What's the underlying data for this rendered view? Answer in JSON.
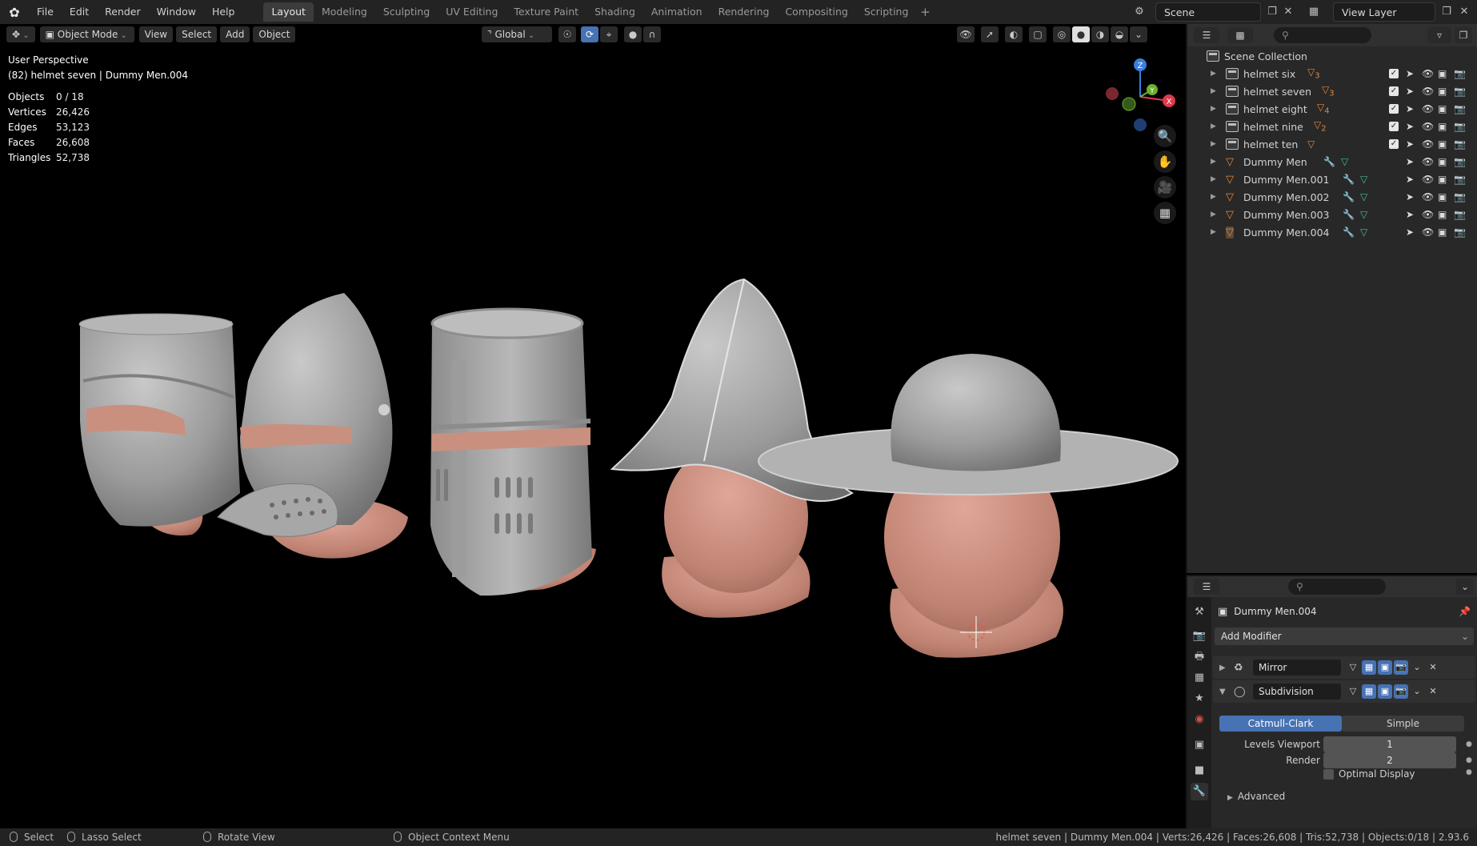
{
  "topbar": {
    "menus": [
      "File",
      "Edit",
      "Render",
      "Window",
      "Help"
    ],
    "workspaces": [
      "Layout",
      "Modeling",
      "Sculpting",
      "UV Editing",
      "Texture Paint",
      "Shading",
      "Animation",
      "Rendering",
      "Compositing",
      "Scripting"
    ],
    "active_workspace": "Layout",
    "scene": "Scene",
    "view_layer": "View Layer"
  },
  "viewport": {
    "mode": "Object Mode",
    "menus": [
      "View",
      "Select",
      "Add",
      "Object"
    ],
    "transform_orientation": "Global",
    "perspective_label": "User Perspective",
    "context_label": "(82) helmet seven | Dummy Men.004",
    "stats": [
      {
        "key": "Objects",
        "value": "0 / 18"
      },
      {
        "key": "Vertices",
        "value": "26,426"
      },
      {
        "key": "Edges",
        "value": "53,123"
      },
      {
        "key": "Faces",
        "value": "26,608"
      },
      {
        "key": "Triangles",
        "value": "52,738"
      }
    ],
    "gizmo_axes": {
      "z": "Z",
      "y": "Y",
      "x": "X"
    },
    "colors": {
      "x_axis": "#e0394d",
      "y_axis": "#6bb02b",
      "z_axis": "#3a7ee0",
      "skin": "#c28575",
      "metal": "#a6a6a6"
    }
  },
  "outliner": {
    "search_placeholder": "",
    "scene_collection": "Scene Collection",
    "items": [
      {
        "label": "helmet six",
        "type": "collection",
        "badge": "3"
      },
      {
        "label": "helmet seven",
        "type": "collection",
        "badge": "3"
      },
      {
        "label": "helmet eight",
        "type": "collection",
        "badge": "4"
      },
      {
        "label": "helmet nine",
        "type": "collection",
        "badge": "2"
      },
      {
        "label": "helmet ten",
        "type": "collection",
        "badge": ""
      },
      {
        "label": "Dummy Men",
        "type": "mesh"
      },
      {
        "label": "Dummy Men.001",
        "type": "mesh"
      },
      {
        "label": "Dummy Men.002",
        "type": "mesh"
      },
      {
        "label": "Dummy Men.003",
        "type": "mesh"
      },
      {
        "label": "Dummy Men.004",
        "type": "mesh"
      }
    ]
  },
  "properties": {
    "search_placeholder": "",
    "object_name": "Dummy Men.004",
    "add_modifier": "Add Modifier",
    "modifiers": [
      {
        "name": "Mirror",
        "expanded": false
      },
      {
        "name": "Subdivision",
        "expanded": true
      }
    ],
    "subdivision": {
      "method_catmull": "Catmull-Clark",
      "method_simple": "Simple",
      "levels_viewport_label": "Levels Viewport",
      "levels_viewport": "1",
      "render_label": "Render",
      "render": "2",
      "optimal_display": "Optimal Display",
      "advanced": "Advanced"
    }
  },
  "statusbar": {
    "select": "Select",
    "lasso": "Lasso Select",
    "rotate": "Rotate View",
    "context_menu": "Object Context Menu",
    "info": "helmet seven | Dummy Men.004 | Verts:26,426 | Faces:26,608 | Tris:52,738 | Objects:0/18 | 2.93.6"
  }
}
